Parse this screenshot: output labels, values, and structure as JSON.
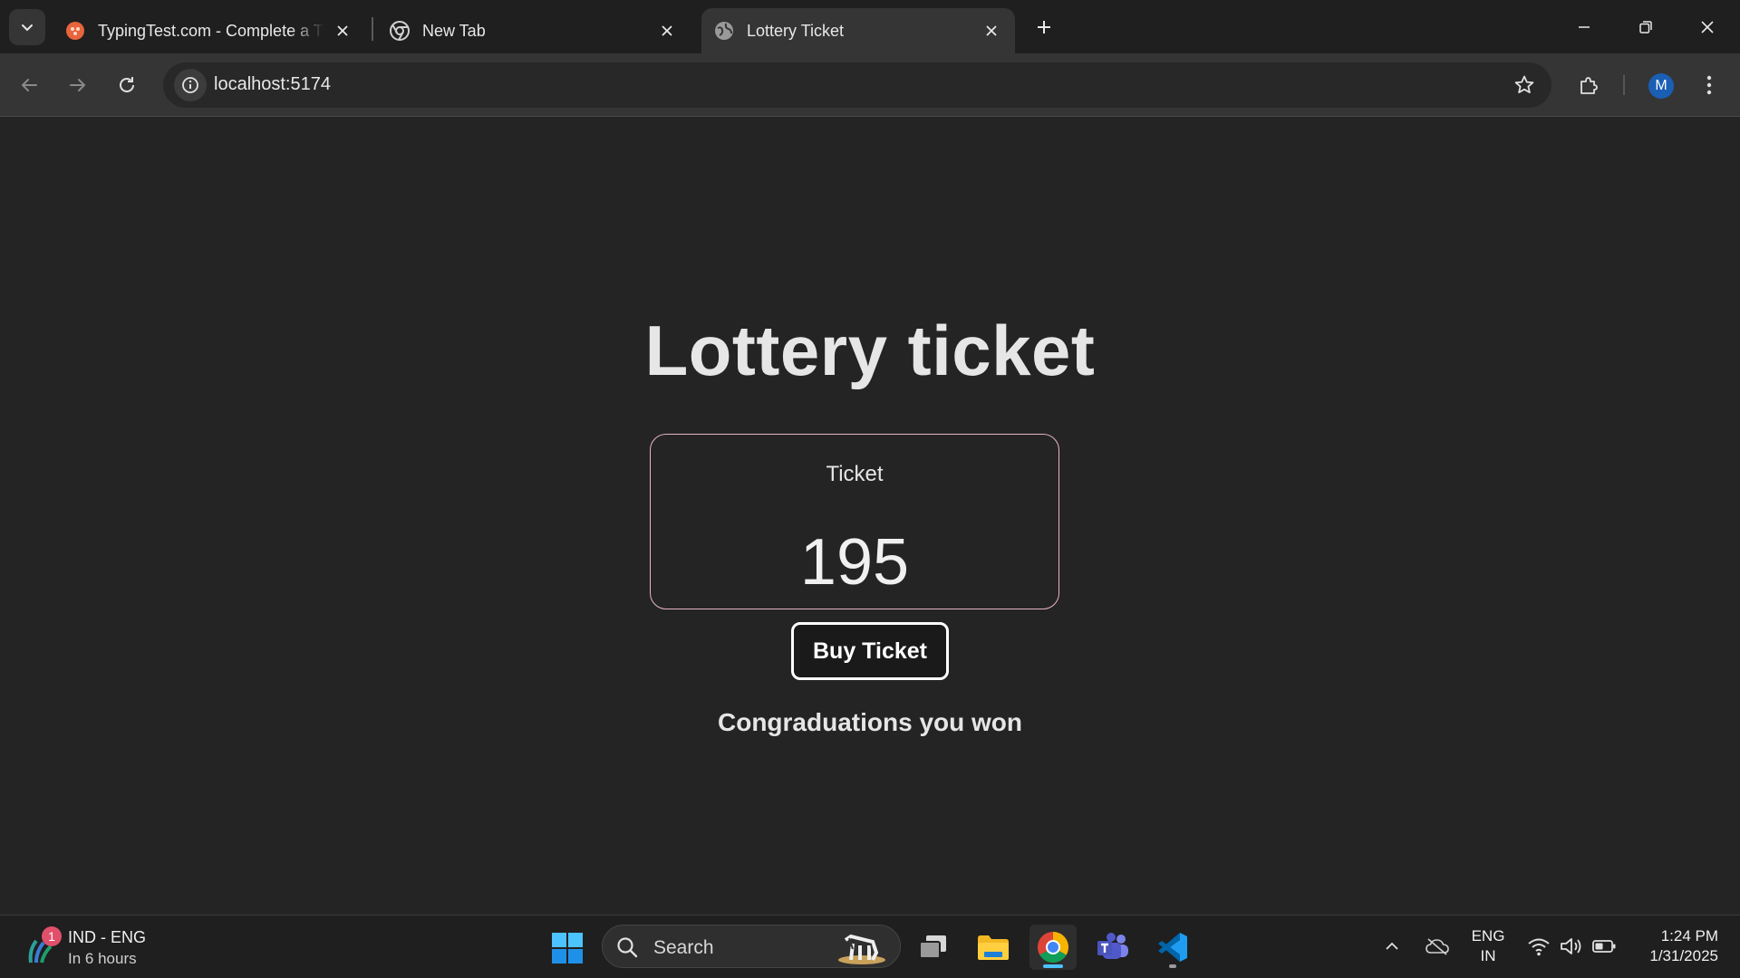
{
  "browser": {
    "tabs": [
      {
        "title": "TypingTest.com - Complete a Ty",
        "favicon": "typingtest-favicon",
        "active": false
      },
      {
        "title": "New Tab",
        "favicon": "chrome-favicon",
        "active": false
      },
      {
        "title": "Lottery Ticket",
        "favicon": "globe-favicon",
        "active": true
      }
    ],
    "url": "localhost:5174",
    "profile_initial": "M",
    "accent": "#1a5fb4"
  },
  "page": {
    "heading": "Lottery ticket",
    "ticket_label": "Ticket",
    "ticket_number": "195",
    "buy_button": "Buy Ticket",
    "result_message": "Congraduations you won",
    "card_border_color": "#e8b5c4"
  },
  "taskbar": {
    "weather": {
      "badge": "1",
      "title": "IND - ENG",
      "subtitle": "In 6 hours"
    },
    "search_placeholder": "Search",
    "language": {
      "line1": "ENG",
      "line2": "IN"
    },
    "clock": {
      "time": "1:24 PM",
      "date": "1/31/2025"
    }
  }
}
